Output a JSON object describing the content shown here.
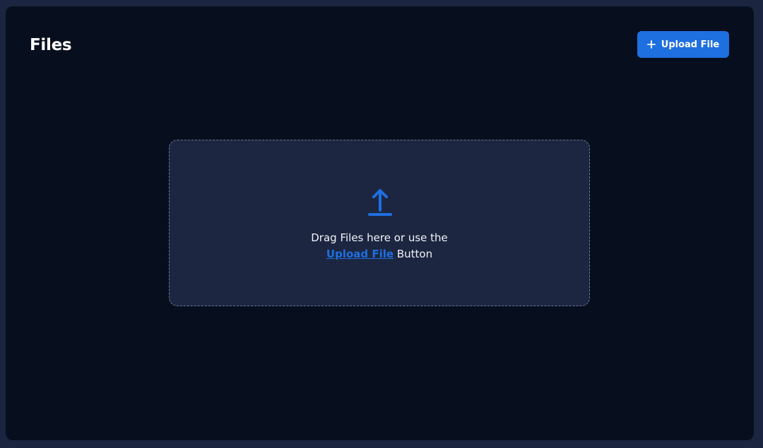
{
  "header": {
    "title": "Files",
    "upload_button_label": "Upload File",
    "upload_button_icon": "plus-icon"
  },
  "dropzone": {
    "icon": "upload-arrow-icon",
    "line1": "Drag Files here or use the",
    "link_label": "Upload File",
    "line2_suffix": " Button"
  },
  "colors": {
    "page_bg": "#1b2540",
    "panel_bg": "#070e1d",
    "dropzone_bg": "#1c2641",
    "accent": "#1e6fe0",
    "text": "#ffffff"
  }
}
